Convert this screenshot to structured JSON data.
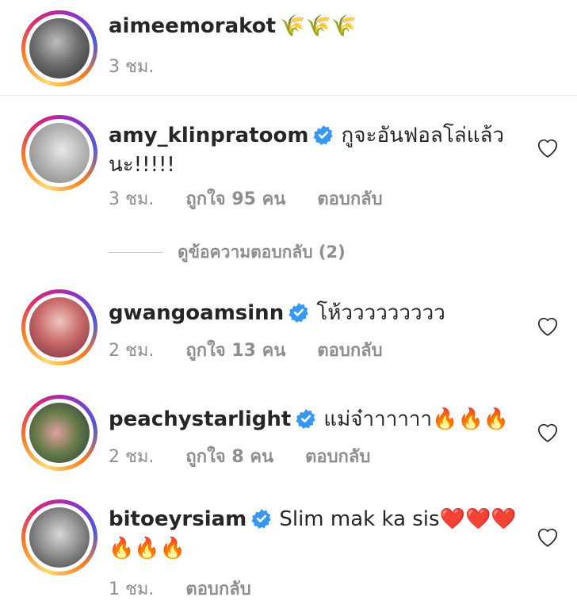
{
  "caption": {
    "username": "aimeemorakot",
    "emoji": "🌾🌾🌾",
    "time": "3 ชม."
  },
  "comments": [
    {
      "username": "amy_klinpratoom",
      "verified": true,
      "text_line1": "กูจะอันฟอลโล่แล้ว",
      "text_line2": "นะ!!!!!",
      "time": "3 ชม.",
      "likes": "ถูกใจ 95 คน",
      "reply": "ตอบกลับ",
      "view_replies": "ดูข้อความตอบกลับ (2)"
    },
    {
      "username": "gwangoamsinn",
      "verified": true,
      "text_line1": "โห้ววววววววว",
      "time": "2 ชม.",
      "likes": "ถูกใจ 13 คน",
      "reply": "ตอบกลับ"
    },
    {
      "username": "peachystarlight",
      "verified": true,
      "text_line1": "แม่จ๋าาาาาา🔥🔥🔥",
      "time": "2 ชม.",
      "likes": "ถูกใจ 8 คน",
      "reply": "ตอบกลับ"
    },
    {
      "username": "bitoeyrsiam",
      "verified": true,
      "text_line1": "Slim mak ka sis❤️❤️❤️",
      "text_line2": "🔥🔥🔥",
      "time": "1 ชม.",
      "reply": "ตอบกลับ"
    }
  ],
  "icons": {
    "verified": "verified-badge-icon",
    "like": "heart-outline-icon"
  },
  "colors": {
    "verified": "#3897f0",
    "meta_text": "#8e8e8e",
    "text": "#262626"
  }
}
